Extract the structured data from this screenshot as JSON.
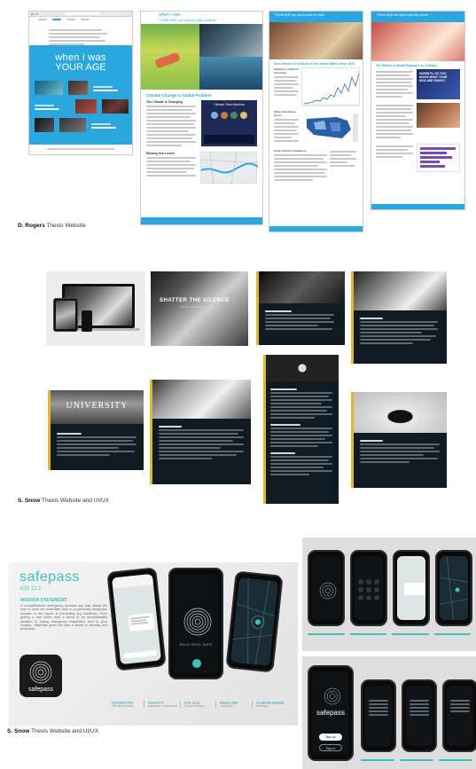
{
  "section1": {
    "caption_name": "D. Rogers",
    "caption_rest": " Thesis Website",
    "laptop_page": {
      "headline_line1": "when i was",
      "headline_line2": "YOUR AGE"
    },
    "page2": {
      "header_line1": "when i was",
      "header_line2": "YOUR AGE we used to play outside!",
      "section_title": "Climate Change is Global Problem",
      "sub_title": "The Climate is Changing",
      "card_title": "Climate Time Machine",
      "raising_title": "Raising Sea Levels"
    },
    "page3": {
      "header_line2": "YOUR AGE we had to learn to read!",
      "section_title": "Gun Violence in Schools in the United States Since 1970",
      "sub1": "Statistics of School Shootings",
      "sub2": "Where Shootings Occur",
      "sub3": "Active Shooter Situations"
    },
    "page4": {
      "header_line2": "YOUR AGE we had to dial the phone!",
      "section_title": "The Effects of Media Exposure on Children",
      "banner_line1": "PARENTS: DO YOU",
      "banner_line2": "KNOW WHAT YOUR",
      "banner_line3": "KIDS ARE DOING?"
    }
  },
  "section2": {
    "caption_name": "S. Snow",
    "caption_rest": " Thesis Website and UI/UX",
    "hero_text": "SHATTER THE SILENCE",
    "hero_sub": "YOUR VOICE MATTERS",
    "university_text": "UNIVERSITY"
  },
  "section3": {
    "caption_name": "S. Snow",
    "caption_rest": " Thesis Website and UI/UX",
    "brand": "safepass",
    "ios": "iOS 12.2",
    "mission_title": "MISSION STATEMENT:",
    "mission_body": "A comprehensive emergency services app that allows the user to seek out immediate help in a potentially dangerous situation in the hopes of preventing any incidence. From getting a ride home from a friend in an uncomfortable situation to having emergency responders sent to your location, SafePass gives the user a sense of security and protection.",
    "app_icon_label": "safepass",
    "hold_text": "HOLD UNTIL SAFE",
    "footer_items": [
      {
        "title": "SAFEPASS",
        "sub": "APP DESIGN DONE"
      },
      {
        "title": "SAFETY",
        "sub": "EMERGENCY ASSISTANCE"
      },
      {
        "title": "iOS 12.0",
        "sub": "IPHONE X DESIGN"
      },
      {
        "title": "ENGLISH",
        "sub": "LANGUAGE"
      },
      {
        "title": "SARAH SNOW",
        "sub": "DESIGNER"
      }
    ],
    "login_brand": "safepass",
    "login_button": "Sign up",
    "login_button2": "Sign In"
  },
  "colors": {
    "blue": "#2aa7df",
    "dark": "#0f1a22",
    "yellow": "#e2b634",
    "teal": "#3fc1b5"
  }
}
